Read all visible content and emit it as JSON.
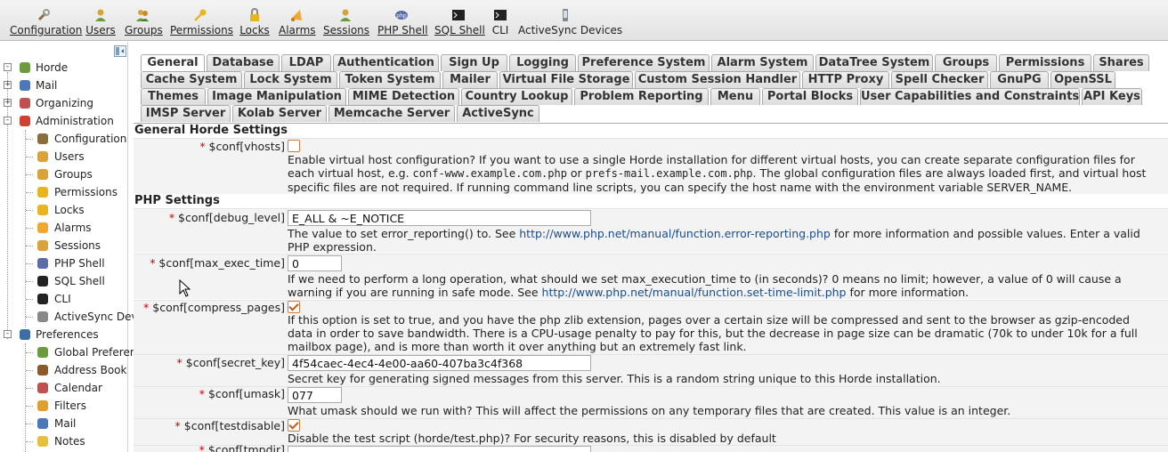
{
  "toolbar": [
    {
      "label": "Configuration",
      "u": "C",
      "icon": "wrench-icon"
    },
    {
      "label": "Users",
      "u": "U",
      "icon": "user-icon"
    },
    {
      "label": "Groups",
      "u": "G",
      "icon": "group-icon"
    },
    {
      "label": "Permissions",
      "u": "P",
      "icon": "key-icon"
    },
    {
      "label": "Locks",
      "u": "L",
      "icon": "lock-icon"
    },
    {
      "label": "Alarms",
      "u": "A",
      "icon": "alarm-icon"
    },
    {
      "label": "Sessions",
      "u": "S",
      "icon": "sessions-icon"
    },
    {
      "label": "PHP Shell",
      "u": "H",
      "icon": "php-icon"
    },
    {
      "label": "SQL Shell",
      "u": "Q",
      "icon": "terminal-icon"
    },
    {
      "label": "CLI",
      "u": "",
      "icon": "terminal-icon"
    },
    {
      "label": "ActiveSync Devices",
      "u": "",
      "icon": "phone-icon"
    }
  ],
  "sidebar": {
    "items": [
      {
        "label": "Horde",
        "icon": "horde-icon"
      },
      {
        "label": "Mail",
        "icon": "mail-icon"
      },
      {
        "label": "Organizing",
        "icon": "organizing-icon"
      },
      {
        "label": "Administration",
        "icon": "administration-icon"
      },
      {
        "label": "Configuration",
        "icon": "wrench-icon"
      },
      {
        "label": "Users",
        "icon": "user-icon"
      },
      {
        "label": "Groups",
        "icon": "group-icon"
      },
      {
        "label": "Permissions",
        "icon": "key-icon"
      },
      {
        "label": "Locks",
        "icon": "lock-icon"
      },
      {
        "label": "Alarms",
        "icon": "alarm-icon"
      },
      {
        "label": "Sessions",
        "icon": "sessions-icon"
      },
      {
        "label": "PHP Shell",
        "icon": "php-icon"
      },
      {
        "label": "SQL Shell",
        "icon": "terminal-icon"
      },
      {
        "label": "CLI",
        "icon": "terminal-icon"
      },
      {
        "label": "ActiveSync Dev",
        "icon": "phone-icon"
      },
      {
        "label": "Preferences",
        "icon": "preferences-icon"
      },
      {
        "label": "Global Preferen",
        "icon": "global-preferences-icon"
      },
      {
        "label": "Address Book",
        "icon": "address-book-icon"
      },
      {
        "label": "Calendar",
        "icon": "calendar-icon"
      },
      {
        "label": "Filters",
        "icon": "filters-icon"
      },
      {
        "label": "Mail",
        "icon": "mail-icon"
      },
      {
        "label": "Notes",
        "icon": "notes-icon"
      }
    ]
  },
  "tabs": {
    "row1": [
      "General",
      "Database",
      "LDAP",
      "Authentication",
      "Sign Up",
      "Logging",
      "Preference System",
      "Alarm System",
      "DataTree System",
      "Groups",
      "Permissions",
      "Shares"
    ],
    "row2": [
      "Cache System",
      "Lock System",
      "Token System",
      "Mailer",
      "Virtual File Storage",
      "Custom Session Handler",
      "HTTP Proxy",
      "Spell Checker",
      "GnuPG",
      "OpenSSL"
    ],
    "row3": [
      "Themes",
      "Image Manipulation",
      "MIME Detection",
      "Country Lookup",
      "Problem Reporting",
      "Menu",
      "Portal Blocks",
      "User Capabilities and Constraints",
      "API Keys"
    ],
    "row4": [
      "IMSP Server",
      "Kolab Server",
      "Memcache Server",
      "ActiveSync"
    ],
    "active": "General"
  },
  "content": {
    "section_general": "General Horde Settings",
    "section_php": "PHP Settings",
    "vhosts": {
      "label": "$conf[vhosts]",
      "desc_a": "Enable virtual host configuration? If you want to use a single Horde installation for different virtual hosts, you can create separate configuration files for each virtual host, e.g. ",
      "mono1": "conf-www.example.com.php",
      "desc_b": " or ",
      "mono2": "prefs-mail.example.com.php",
      "desc_c": ". The global configuration files are always loaded first, and virtual host specific files are not required. If running command line scripts, you can specify the host name with the environment variable SERVER_NAME."
    },
    "debug_level": {
      "label": "$conf[debug_level]",
      "value": "E_ALL & ~E_NOTICE",
      "desc_a": "The value to set error_reporting() to. See ",
      "link": "http://www.php.net/manual/function.error-reporting.php",
      "desc_b": " for more information and possible values. Enter a valid PHP expression."
    },
    "max_exec_time": {
      "label": "$conf[max_exec_time]",
      "value": "0",
      "desc_a": "If we need to perform a long operation, what should we set max_execution_time to (in seconds)? 0 means no limit; however, a value of 0 will cause a warning if you are running in safe mode. See ",
      "link": "http://www.php.net/manual/function.set-time-limit.php",
      "desc_b": " for more information."
    },
    "compress_pages": {
      "label": "$conf[compress_pages]",
      "desc": "If this option is set to true, and you have the php zlib extension, pages over a certain size will be compressed and sent to the browser as gzip-encoded data in order to save bandwidth. There is a CPU-usage penalty to pay for this, but the decrease in page size can be dramatic (70k to under 10k for a full mailbox page), and is more than worth it over anything but an extremely fast link."
    },
    "secret_key": {
      "label": "$conf[secret_key]",
      "value": "4f54caec-4ec4-4e00-aa60-407ba3c4f368",
      "desc": "Secret key for generating signed messages from this server. This is a random string unique to this Horde installation."
    },
    "umask": {
      "label": "$conf[umask]",
      "value": "077",
      "desc": "What umask should we run with? This will affect the permissions on any temporary files that are created. This value is an integer."
    },
    "testdisable": {
      "label": "$conf[testdisable]",
      "desc": "Disable the test script (horde/test.php)? For security reasons, this is disabled by default"
    },
    "tmpdir": {
      "label": "$conf[tmpdir]"
    },
    "required_marker": "*"
  }
}
